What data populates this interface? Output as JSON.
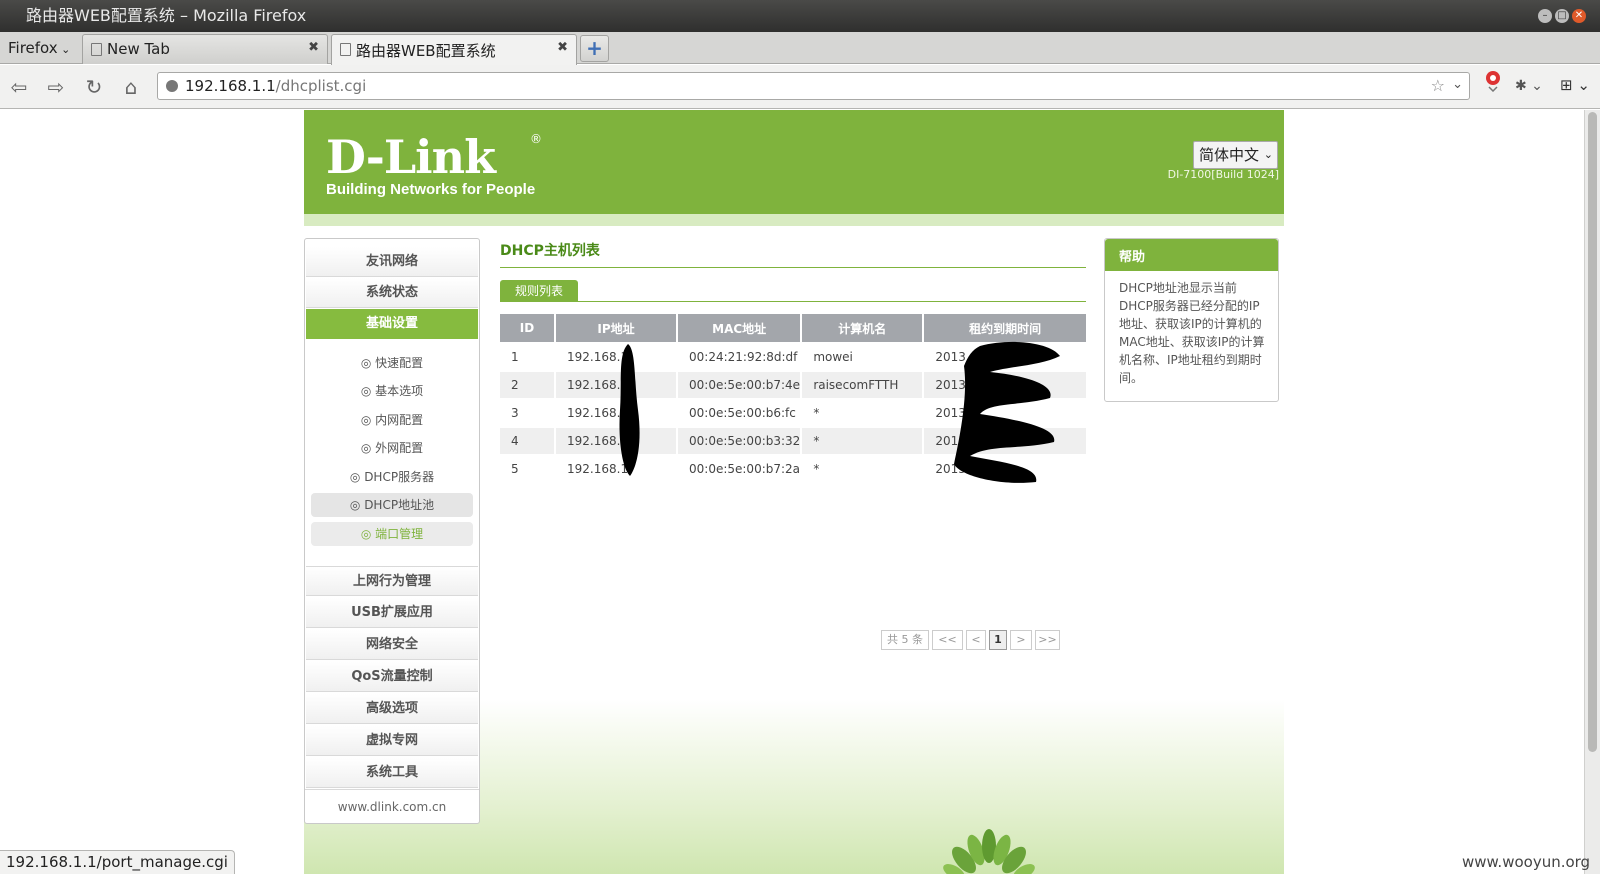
{
  "window": {
    "title": "路由器WEB配置系统 – Mozilla Firefox"
  },
  "browser": {
    "menu_label": "Firefox",
    "tabs": [
      {
        "title": "New Tab",
        "close": "✖"
      },
      {
        "title": "路由器WEB配置系统",
        "close": "✖"
      }
    ],
    "newtab_label": "+",
    "url": {
      "host": "192.168.1.1",
      "path": "/dhcplist.cgi"
    }
  },
  "header": {
    "logo_brand": "D-Link",
    "logo_reg": "®",
    "logo_tagline": "Building Networks for People",
    "language": "简体中文",
    "build": "DI-7100[Build 1024]"
  },
  "sidebar": {
    "top": [
      {
        "label": "友讯网络"
      },
      {
        "label": "系统状态"
      },
      {
        "label": "基础设置"
      }
    ],
    "sub": [
      {
        "label": "◎ 快速配置"
      },
      {
        "label": "◎ 基本选项"
      },
      {
        "label": "◎ 内网配置"
      },
      {
        "label": "◎ 外网配置"
      },
      {
        "label": "◎ DHCP服务器"
      },
      {
        "label": "◎ DHCP地址池"
      },
      {
        "label": "◎ 端口管理"
      }
    ],
    "bottom": [
      {
        "label": "上网行为管理"
      },
      {
        "label": "USB扩展应用"
      },
      {
        "label": "网络安全"
      },
      {
        "label": "QoS流量控制"
      },
      {
        "label": "高级选项"
      },
      {
        "label": "虚拟专网"
      },
      {
        "label": "系统工具"
      }
    ],
    "footer": "www.dlink.com.cn"
  },
  "main": {
    "title": "DHCP主机列表",
    "subtab": "规则列表",
    "columns": [
      "ID",
      "IP地址",
      "MAC地址",
      "计算机名",
      "租约到期时间"
    ],
    "rows": [
      {
        "id": "1",
        "ip": "192.168.1",
        "mac": "00:24:21:92:8d:df",
        "name": "mowei",
        "expire": "2013"
      },
      {
        "id": "2",
        "ip": "192.168.1",
        "mac": "00:0e:5e:00:b7:4e",
        "name": "raisecomFTTH",
        "expire": "2013"
      },
      {
        "id": "3",
        "ip": "192.168.1",
        "mac": "00:0e:5e:00:b6:fc",
        "name": "*",
        "expire": "2013"
      },
      {
        "id": "4",
        "ip": "192.168.1",
        "mac": "00:0e:5e:00:b3:32",
        "name": "*",
        "expire": "2013"
      },
      {
        "id": "5",
        "ip": "192.168.1",
        "mac": "00:0e:5e:00:b7:2a",
        "name": "*",
        "expire": "2013"
      }
    ],
    "pager": {
      "total": "共 5 条",
      "first": "<<",
      "prev": "<",
      "page": "1",
      "next": ">",
      "last": ">>"
    }
  },
  "help": {
    "title": "帮助",
    "text": "DHCP地址池显示当前DHCP服务器已经分配的IP地址、获取该IP的计算机的MAC地址、获取该IP的计算机名称、IP地址租约到期时间。"
  },
  "status_url": "192.168.1.1/port_manage.cgi",
  "watermark": "www.wooyun.org",
  "colors": {
    "brand_green": "#7fb33d",
    "header_gray": "#a3a6ab"
  }
}
